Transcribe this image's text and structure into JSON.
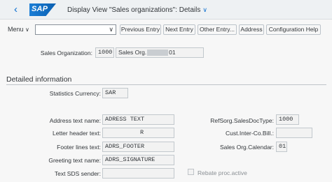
{
  "shell": {
    "logo_text": "SAP",
    "title": "Display View \"Sales organizations\": Details",
    "title_chevron": "∨",
    "back_icon": "‹"
  },
  "toolbar": {
    "menu_label": "Menu",
    "menu_chevron": "∨",
    "combo_value": "",
    "combo_chevron": "∨",
    "buttons": [
      "Previous Entry",
      "Next Entry",
      "Other Entry...",
      "Address",
      "Configuration Help"
    ]
  },
  "header": {
    "sales_org_label": "Sales Organization:",
    "sales_org_value": "1000",
    "sales_org_name_prefix": "Sales Org.",
    "sales_org_name_suffix": "01"
  },
  "section": {
    "title": "Detailed information"
  },
  "fields": {
    "stat_currency_label": "Statistics Currency:",
    "stat_currency_value": "SAR",
    "address_text_label": "Address text name:",
    "address_text_value": "ADRESS TEXT",
    "letter_header_label": "Letter header text:",
    "letter_header_value": "R",
    "footer_lines_label": "Footer lines text:",
    "footer_lines_value": "ADRS_FOOTER",
    "greeting_label": "Greeting text name:",
    "greeting_value": "ADRS_SIGNATURE",
    "text_sds_label": "Text SDS sender:",
    "text_sds_value": "",
    "refsorg_label": "RefSorg.SalesDocType:",
    "refsorg_value": "1000",
    "cust_inter_label": "Cust.Inter-Co.Bill.:",
    "cust_inter_value": "",
    "sales_cal_label": "Sales Org.Calendar:",
    "sales_cal_value": "01",
    "rebate_label": "Rebate proc.active"
  }
}
